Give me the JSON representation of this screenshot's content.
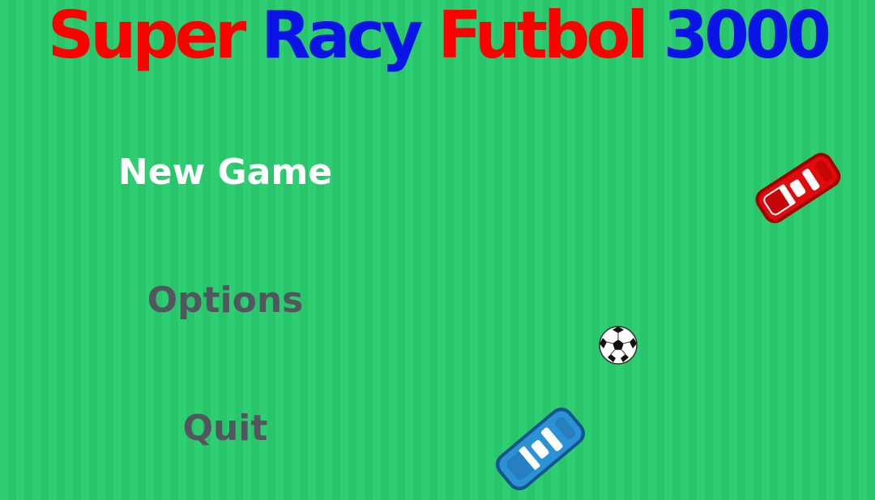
{
  "title": {
    "words": [
      "Super",
      "Racy",
      "Futbol",
      "3000"
    ],
    "colors": [
      "#ff0000",
      "#0a14e6",
      "#ff0000",
      "#0a14e6"
    ]
  },
  "menu": {
    "items": [
      {
        "label": "New Game",
        "color": "#ffffff",
        "state": "selected"
      },
      {
        "label": "Options",
        "color": "#55555f",
        "state": "normal"
      },
      {
        "label": "Quit",
        "color": "#55555f",
        "state": "normal"
      }
    ]
  },
  "sprites": {
    "player_car": {
      "icon": "red-car-icon",
      "color": "#e00b0b"
    },
    "opponent_car": {
      "icon": "blue-car-icon",
      "color": "#2c92d6"
    },
    "ball": {
      "icon": "soccer-ball-icon"
    }
  },
  "colors": {
    "field": "#2ecf72",
    "field_stripe": "#29c56b"
  }
}
